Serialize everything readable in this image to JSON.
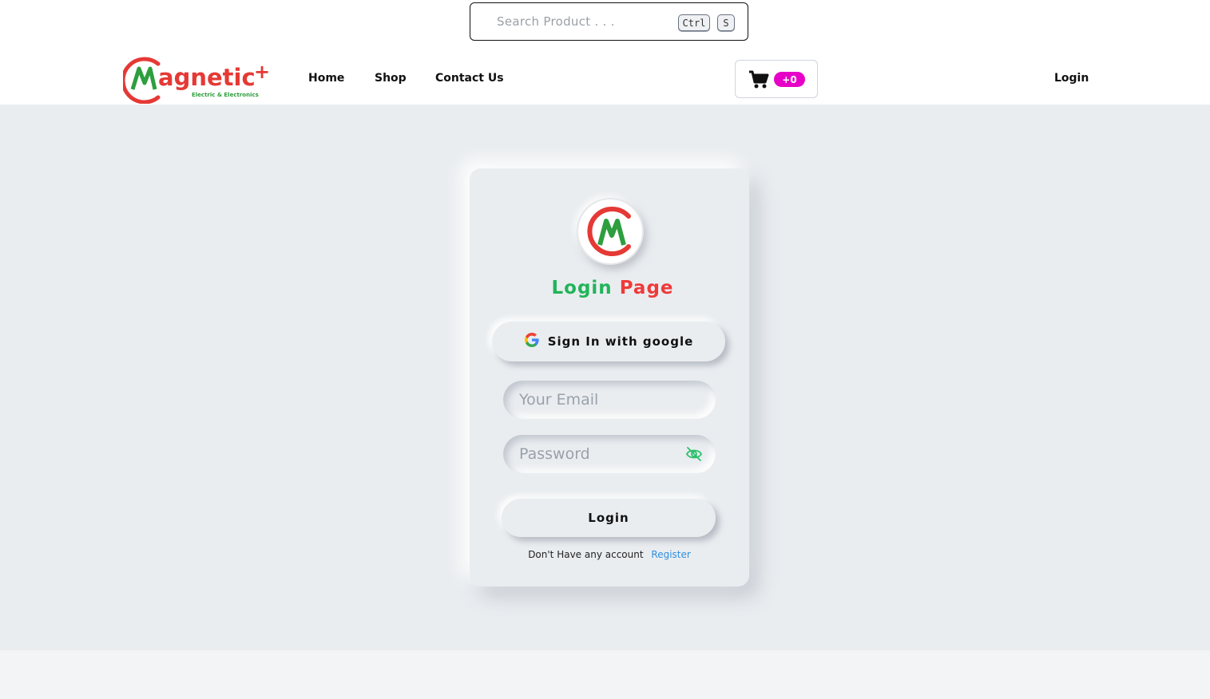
{
  "search": {
    "placeholder": "Search Product . . .",
    "shortcut_key1": "Ctrl",
    "shortcut_key2": "S"
  },
  "nav": {
    "logo_text": "Magnetic",
    "logo_tagline": "Electric & Electronics",
    "links": [
      "Home",
      "Shop",
      "Contact Us"
    ],
    "cart_count": "+0",
    "login": "Login"
  },
  "card": {
    "title_part1": "Login",
    "title_part2": "Page",
    "google_label": "Sign In with google",
    "email_placeholder": "Your Email",
    "password_placeholder": "Password",
    "login_button": "Login",
    "register_prompt": "Don't Have any account",
    "register_link": "Register"
  },
  "colors": {
    "brand_green": "#22b45a",
    "brand_red": "#ef3a3a",
    "cart_badge": "#e600c8",
    "link_blue": "#2f8fe0",
    "background": "#eaedf0"
  }
}
